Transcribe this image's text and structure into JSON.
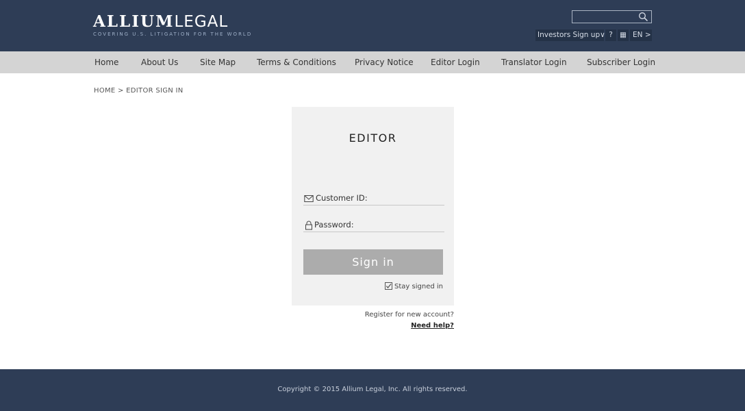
{
  "header": {
    "logo_bold": "ALLIUM",
    "logo_light": "LEGAL",
    "logo_tagline": "COVERING U.S. LITIGATION FOR THE WORLD",
    "search_placeholder": "",
    "investors_label": "Investors Sign up∨",
    "help_label": "?",
    "grid_label": "▦",
    "lang_label": "EN  >"
  },
  "nav": {
    "items": [
      {
        "label": "Home"
      },
      {
        "label": "About Us"
      },
      {
        "label": "Site Map"
      },
      {
        "label": "Terms & Conditions"
      },
      {
        "label": "Privacy Notice"
      },
      {
        "label": "Editor Login"
      },
      {
        "label": "Translator Login"
      },
      {
        "label": "Subscriber Login"
      }
    ]
  },
  "breadcrumb": "HOME > EDITOR SIGN IN",
  "login": {
    "title": "EDITOR",
    "customer_id_label": "Customer ID:",
    "password_label": "Password:",
    "signin_label": "Sign  in",
    "stay_signed_in_label": "Stay signed in",
    "register_link": "Register for new account?",
    "help_link": "Need help?"
  },
  "footer": {
    "copyright": "Copyright © 2015 Allium Legal, Inc. All rights reserved."
  },
  "colors": {
    "header_bg": "#2e3d56",
    "nav_bg": "#d4d4d4",
    "panel_bg": "#f1f1f1",
    "button_bg": "#acacac"
  },
  "icons": [
    "search-icon",
    "envelope-icon",
    "lock-icon",
    "checkbox-checked-icon",
    "grid-icon"
  ]
}
